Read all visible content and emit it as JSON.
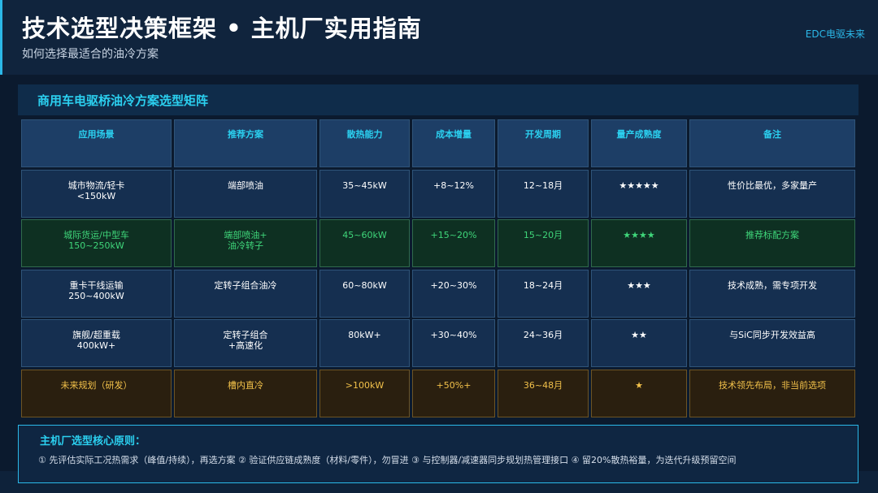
{
  "header": {
    "title": "技术选型决策框架 • 主机厂实用指南",
    "subtitle": "如何选择最适合的油冷方案",
    "brand": "EDC电驱未来"
  },
  "section": {
    "title": "商用车电驱桥油冷方案选型矩阵"
  },
  "table": {
    "headers": [
      "应用场景",
      "推荐方案",
      "散热能力",
      "成本增量",
      "开发周期",
      "量产成熟度",
      "备注"
    ],
    "rows": [
      {
        "cells": [
          "城市物流/轻卡\n<150kW",
          "端部喷油",
          "35~45kW",
          "+8~12%",
          "12~18月",
          "★★★★★",
          "性价比最优，多家量产"
        ],
        "style": "normal"
      },
      {
        "cells": [
          "城际货运/中型车\n150~250kW",
          "端部喷油+\n油冷转子",
          "45~60kW",
          "+15~20%",
          "15~20月",
          "★★★★",
          "推荐标配方案"
        ],
        "style": "green"
      },
      {
        "cells": [
          "重卡干线运输\n250~400kW",
          "定转子组合油冷",
          "60~80kW",
          "+20~30%",
          "18~24月",
          "★★★",
          "技术成熟，需专项开发"
        ],
        "style": "normal"
      },
      {
        "cells": [
          "旗舰/超重载\n400kW+",
          "定转子组合\n+高速化",
          "80kW+",
          "+30~40%",
          "24~36月",
          "★★",
          "与SiC同步开发效益高"
        ],
        "style": "normal"
      },
      {
        "cells": [
          "未来规划（研发）",
          "槽内直冷",
          ">100kW",
          "+50%+",
          "36~48月",
          "★",
          "技术领先布局，非当前选项"
        ],
        "style": "amber"
      }
    ]
  },
  "principles": {
    "title": "主机厂选型核心原则：",
    "text": "① 先评估实际工况热需求（峰值/持续），再选方案 ② 验证供应链成熟度（材料/零件），勿冒进 ③ 与控制器/减速器同步规划热管理接口 ④ 留20%散热裕量，为迭代升级预留空间"
  }
}
